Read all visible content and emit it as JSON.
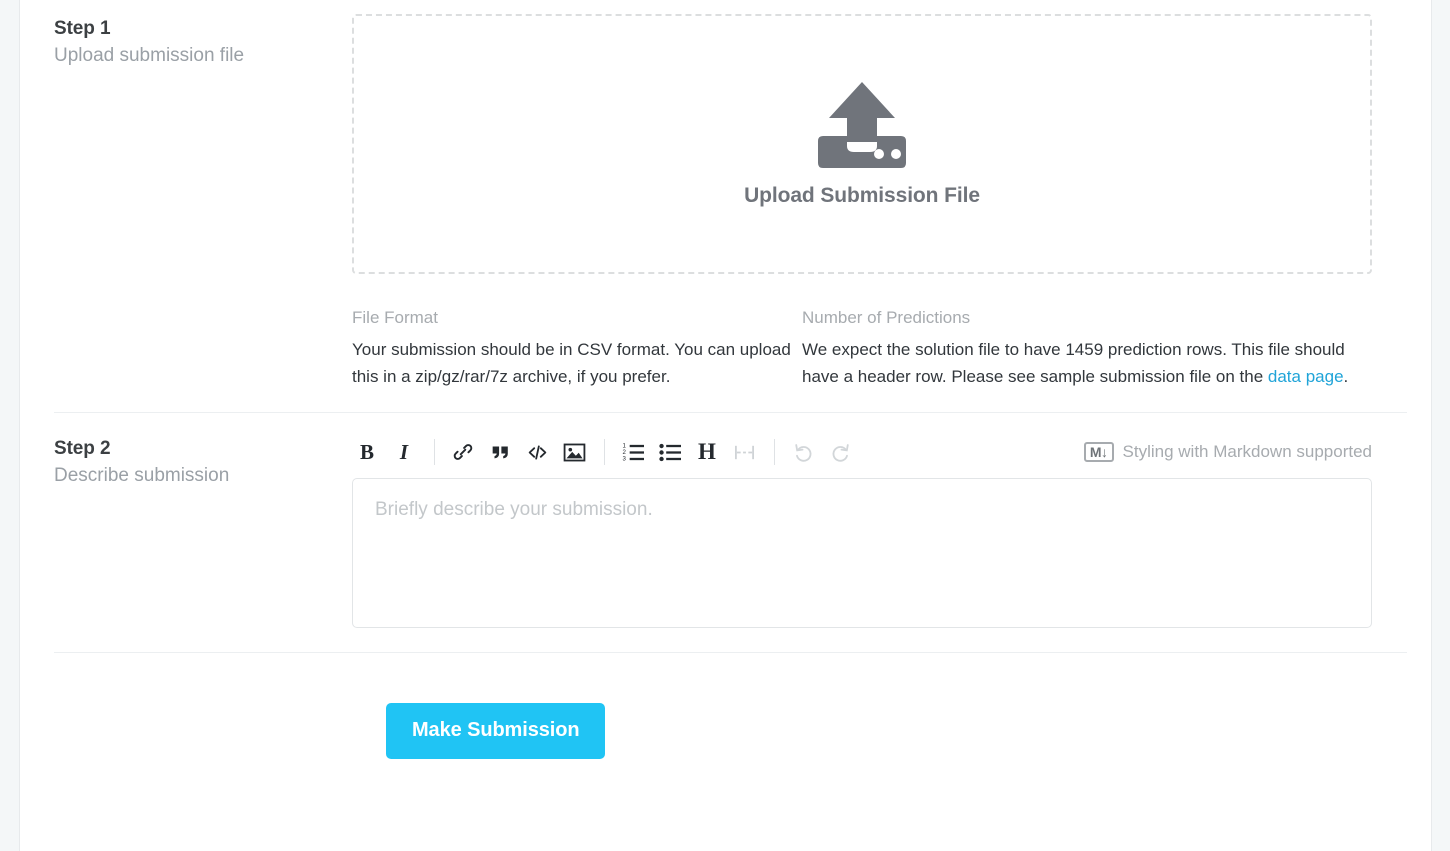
{
  "steps": [
    {
      "title": "Step 1",
      "subtitle": "Upload submission file",
      "dropzone_label": "Upload Submission File",
      "info": [
        {
          "heading": "File Format",
          "text": "Your submission should be in CSV format. You can upload this in a zip/gz/rar/7z archive, if you prefer."
        },
        {
          "heading": "Number of Predictions",
          "text_before_link": "We expect the solution file to have 1459 prediction rows. This file should have a header row. Please see sample submission file on the ",
          "link_text": "data page",
          "text_after_link": "."
        }
      ]
    },
    {
      "title": "Step 2",
      "subtitle": "Describe submission",
      "placeholder": "Briefly describe your submission.",
      "toolbar": {
        "bold": "B",
        "italic": "I",
        "link": "link-icon",
        "quote": "“",
        "code": "</>",
        "image": "image-icon",
        "ordered_list": "ordered-list-icon",
        "unordered_list": "unordered-list-icon",
        "heading": "H",
        "horizontal_rule": "horizontal-rule-icon",
        "undo": "undo-icon",
        "redo": "redo-icon"
      },
      "markdown_note": {
        "badge": "M↓",
        "label": "Styling with Markdown supported"
      }
    }
  ],
  "submit": {
    "label": "Make Submission"
  },
  "colors": {
    "accent": "#20c4f4",
    "link": "#20a4d8",
    "muted_text": "#a7abaf",
    "body_text": "#32373c",
    "icon_gray": "#70747b"
  }
}
